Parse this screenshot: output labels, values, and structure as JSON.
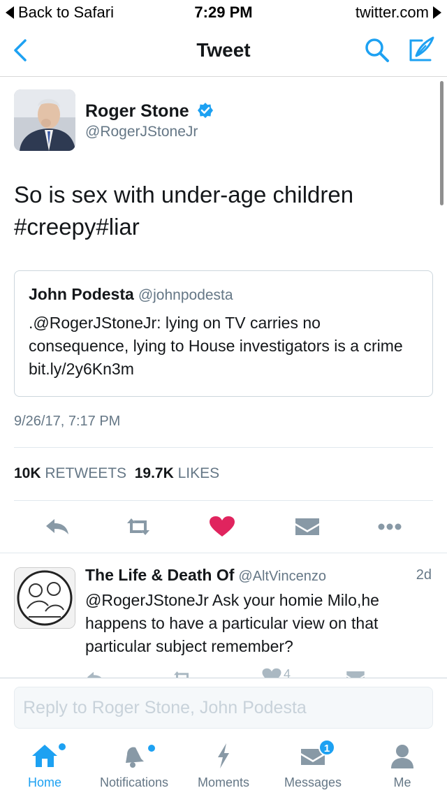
{
  "status_bar": {
    "back_label": "Back to Safari",
    "time": "7:29 PM",
    "url": "twitter.com"
  },
  "nav": {
    "title": "Tweet",
    "icons": {
      "back": "chevron-left-icon",
      "search": "search-icon",
      "compose": "compose-icon"
    }
  },
  "tweet": {
    "author_name": "Roger Stone",
    "author_handle": "@RogerJStoneJr",
    "verified": true,
    "text": "So is sex with under-age children\n#creepy#liar",
    "quoted": {
      "author_name": "John Podesta",
      "author_handle": "@johnpodesta",
      "text": ".@RogerJStoneJr: lying on TV carries no consequence, lying to House investigators is a crime bit.ly/2y6Kn3m"
    },
    "timestamp": "9/26/17, 7:17 PM",
    "stats": {
      "retweets_count": "10K",
      "retweets_label": "RETWEETS",
      "likes_count": "19.7K",
      "likes_label": "LIKES"
    },
    "actions": [
      "reply-icon",
      "retweet-icon",
      "heart-icon",
      "dm-envelope-icon",
      "more-icon"
    ],
    "liked": true
  },
  "reply": {
    "author_name": "The Life & Death Of",
    "author_handle": "@AltVincenzo",
    "time": "2d",
    "text": "@RogerJStoneJr Ask your homie Milo,he happens to have a particular view on that particular subject remember?",
    "likes_count": "4"
  },
  "composer": {
    "placeholder": "Reply to Roger Stone, John Podesta",
    "value": ""
  },
  "tab_bar": {
    "tabs": [
      {
        "label": "Home",
        "icon": "home-icon",
        "active": true
      },
      {
        "label": "Notifications",
        "icon": "bell-icon",
        "active": false
      },
      {
        "label": "Moments",
        "icon": "lightning-icon",
        "active": false
      },
      {
        "label": "Messages",
        "icon": "envelope-icon",
        "active": false,
        "badge": "1"
      },
      {
        "label": "Me",
        "icon": "person-icon",
        "active": false
      }
    ]
  },
  "colors": {
    "accent": "#1da1f2",
    "like": "#e0245e",
    "muted": "#657786",
    "text": "#14171a"
  }
}
